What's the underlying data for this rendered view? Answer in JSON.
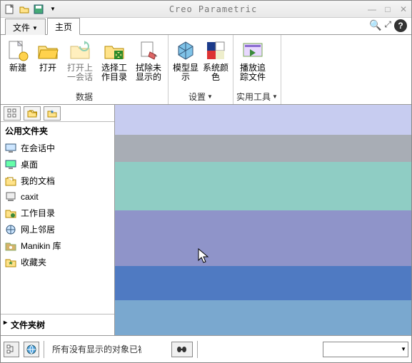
{
  "app": {
    "title": "Creo Parametric"
  },
  "tabs": {
    "file": "文件",
    "home": "主页"
  },
  "ribbon": {
    "new": "新建",
    "open": "打开",
    "open_last": "打开上一会话",
    "select_wd": "选择工作目录",
    "erase_undisp": "拭除未显示的",
    "model_disp": "模型显示",
    "sys_colors": "系统颜色",
    "play_trail": "播放追踪文件",
    "grp_data": "数据",
    "grp_settings": "设置",
    "grp_utils": "实用工具"
  },
  "folders": {
    "header": "公用文件夹",
    "items": [
      {
        "label": "在会话中",
        "icon": "monitor"
      },
      {
        "label": "桌面",
        "icon": "desktop"
      },
      {
        "label": "我的文档",
        "icon": "mydocs"
      },
      {
        "label": "caxit",
        "icon": "computer"
      },
      {
        "label": "工作目录",
        "icon": "workdir"
      },
      {
        "label": "网上邻居",
        "icon": "network"
      },
      {
        "label": "Manikin 库",
        "icon": "manikin"
      },
      {
        "label": "收藏夹",
        "icon": "fav"
      }
    ],
    "tree": "文件夹树"
  },
  "status": {
    "message": "所有没有显示的对象已被刷"
  }
}
